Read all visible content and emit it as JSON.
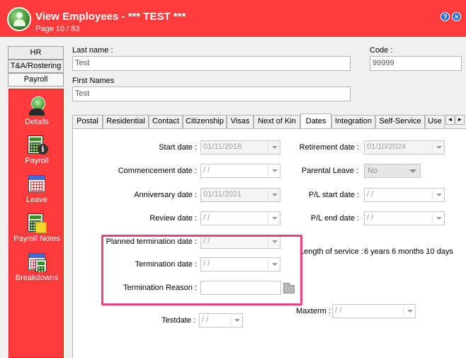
{
  "window": {
    "title": "View Employees - *** TEST ***",
    "page_counter": "Page 10 / 83",
    "help_label": "?",
    "close_label": "×"
  },
  "nav": {
    "tabs": [
      "HR",
      "T&A/Rostering",
      "Payroll"
    ],
    "items": [
      {
        "label": "Details",
        "icon": "employee-details-icon"
      },
      {
        "label": "Payroll",
        "icon": "payroll-calculator-icon"
      },
      {
        "label": "Leave",
        "icon": "calendar-icon"
      },
      {
        "label": "Payroll Notes",
        "icon": "calculator-note-icon"
      },
      {
        "label": "Breakdowns",
        "icon": "calendar-calculator-icon"
      }
    ]
  },
  "form": {
    "last_name_label": "Last name :",
    "last_name_value": "Test",
    "code_label": "Code :",
    "code_value": "99999",
    "first_names_label": "First Names",
    "first_names_value": "Test"
  },
  "tabs": {
    "items": [
      "Postal",
      "Residential",
      "Contact",
      "Citizenship",
      "Visas",
      "Next of Kin",
      "Dates",
      "Integration",
      "Self-Service",
      "Use"
    ],
    "active": "Dates",
    "prev_label": "◄",
    "next_label": "►"
  },
  "dates": {
    "start_date_label": "Start date :",
    "start_date_value": "01/11/2018",
    "commencement_date_label": "Commencement date :",
    "commencement_date_value": " /  /",
    "anniversary_date_label": "Anniversary date :",
    "anniversary_date_value": "01/11/2021",
    "review_date_label": "Review date :",
    "review_date_value": " /  /",
    "planned_termination_label": "Planned termination date :",
    "planned_termination_value": " /  /",
    "termination_date_label": "Termination date :",
    "termination_date_value": " /  /",
    "termination_reason_label": "Termination Reason :",
    "termination_reason_value": "",
    "testdate_label": "Testdate :",
    "testdate_value": " /  /",
    "retirement_date_label": "Retirement date :",
    "retirement_date_value": "01/10/2024",
    "parental_leave_label": "Parental Leave :",
    "parental_leave_value": "No",
    "pl_start_label": "P/L start date :",
    "pl_start_value": " /  /",
    "pl_end_label": "P/L end date :",
    "pl_end_value": " /  /",
    "length_of_service_label": "Length of service :",
    "length_of_service_value": "6 years 6 months 10 days",
    "maxterm_label": "Maxterm :",
    "maxterm_value": " /  /"
  },
  "colors": {
    "accent_red": "#ff3b3b",
    "highlight": "#e8457a"
  }
}
